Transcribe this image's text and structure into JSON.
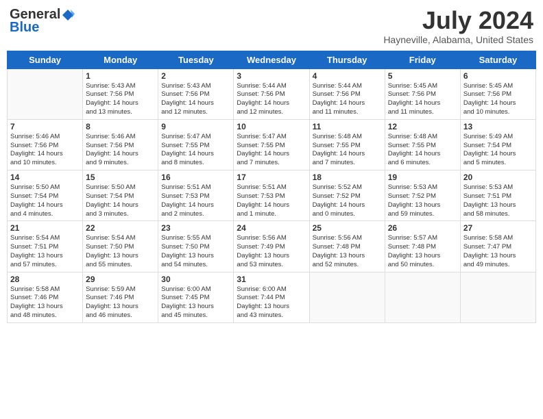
{
  "header": {
    "logo_general": "General",
    "logo_blue": "Blue",
    "month_title": "July 2024",
    "location": "Hayneville, Alabama, United States"
  },
  "days_of_week": [
    "Sunday",
    "Monday",
    "Tuesday",
    "Wednesday",
    "Thursday",
    "Friday",
    "Saturday"
  ],
  "weeks": [
    [
      {
        "day": "",
        "info": ""
      },
      {
        "day": "1",
        "info": "Sunrise: 5:43 AM\nSunset: 7:56 PM\nDaylight: 14 hours\nand 13 minutes."
      },
      {
        "day": "2",
        "info": "Sunrise: 5:43 AM\nSunset: 7:56 PM\nDaylight: 14 hours\nand 12 minutes."
      },
      {
        "day": "3",
        "info": "Sunrise: 5:44 AM\nSunset: 7:56 PM\nDaylight: 14 hours\nand 12 minutes."
      },
      {
        "day": "4",
        "info": "Sunrise: 5:44 AM\nSunset: 7:56 PM\nDaylight: 14 hours\nand 11 minutes."
      },
      {
        "day": "5",
        "info": "Sunrise: 5:45 AM\nSunset: 7:56 PM\nDaylight: 14 hours\nand 11 minutes."
      },
      {
        "day": "6",
        "info": "Sunrise: 5:45 AM\nSunset: 7:56 PM\nDaylight: 14 hours\nand 10 minutes."
      }
    ],
    [
      {
        "day": "7",
        "info": "Sunrise: 5:46 AM\nSunset: 7:56 PM\nDaylight: 14 hours\nand 10 minutes."
      },
      {
        "day": "8",
        "info": "Sunrise: 5:46 AM\nSunset: 7:56 PM\nDaylight: 14 hours\nand 9 minutes."
      },
      {
        "day": "9",
        "info": "Sunrise: 5:47 AM\nSunset: 7:55 PM\nDaylight: 14 hours\nand 8 minutes."
      },
      {
        "day": "10",
        "info": "Sunrise: 5:47 AM\nSunset: 7:55 PM\nDaylight: 14 hours\nand 7 minutes."
      },
      {
        "day": "11",
        "info": "Sunrise: 5:48 AM\nSunset: 7:55 PM\nDaylight: 14 hours\nand 7 minutes."
      },
      {
        "day": "12",
        "info": "Sunrise: 5:48 AM\nSunset: 7:55 PM\nDaylight: 14 hours\nand 6 minutes."
      },
      {
        "day": "13",
        "info": "Sunrise: 5:49 AM\nSunset: 7:54 PM\nDaylight: 14 hours\nand 5 minutes."
      }
    ],
    [
      {
        "day": "14",
        "info": "Sunrise: 5:50 AM\nSunset: 7:54 PM\nDaylight: 14 hours\nand 4 minutes."
      },
      {
        "day": "15",
        "info": "Sunrise: 5:50 AM\nSunset: 7:54 PM\nDaylight: 14 hours\nand 3 minutes."
      },
      {
        "day": "16",
        "info": "Sunrise: 5:51 AM\nSunset: 7:53 PM\nDaylight: 14 hours\nand 2 minutes."
      },
      {
        "day": "17",
        "info": "Sunrise: 5:51 AM\nSunset: 7:53 PM\nDaylight: 14 hours\nand 1 minute."
      },
      {
        "day": "18",
        "info": "Sunrise: 5:52 AM\nSunset: 7:52 PM\nDaylight: 14 hours\nand 0 minutes."
      },
      {
        "day": "19",
        "info": "Sunrise: 5:53 AM\nSunset: 7:52 PM\nDaylight: 13 hours\nand 59 minutes."
      },
      {
        "day": "20",
        "info": "Sunrise: 5:53 AM\nSunset: 7:51 PM\nDaylight: 13 hours\nand 58 minutes."
      }
    ],
    [
      {
        "day": "21",
        "info": "Sunrise: 5:54 AM\nSunset: 7:51 PM\nDaylight: 13 hours\nand 57 minutes."
      },
      {
        "day": "22",
        "info": "Sunrise: 5:54 AM\nSunset: 7:50 PM\nDaylight: 13 hours\nand 55 minutes."
      },
      {
        "day": "23",
        "info": "Sunrise: 5:55 AM\nSunset: 7:50 PM\nDaylight: 13 hours\nand 54 minutes."
      },
      {
        "day": "24",
        "info": "Sunrise: 5:56 AM\nSunset: 7:49 PM\nDaylight: 13 hours\nand 53 minutes."
      },
      {
        "day": "25",
        "info": "Sunrise: 5:56 AM\nSunset: 7:48 PM\nDaylight: 13 hours\nand 52 minutes."
      },
      {
        "day": "26",
        "info": "Sunrise: 5:57 AM\nSunset: 7:48 PM\nDaylight: 13 hours\nand 50 minutes."
      },
      {
        "day": "27",
        "info": "Sunrise: 5:58 AM\nSunset: 7:47 PM\nDaylight: 13 hours\nand 49 minutes."
      }
    ],
    [
      {
        "day": "28",
        "info": "Sunrise: 5:58 AM\nSunset: 7:46 PM\nDaylight: 13 hours\nand 48 minutes."
      },
      {
        "day": "29",
        "info": "Sunrise: 5:59 AM\nSunset: 7:46 PM\nDaylight: 13 hours\nand 46 minutes."
      },
      {
        "day": "30",
        "info": "Sunrise: 6:00 AM\nSunset: 7:45 PM\nDaylight: 13 hours\nand 45 minutes."
      },
      {
        "day": "31",
        "info": "Sunrise: 6:00 AM\nSunset: 7:44 PM\nDaylight: 13 hours\nand 43 minutes."
      },
      {
        "day": "",
        "info": ""
      },
      {
        "day": "",
        "info": ""
      },
      {
        "day": "",
        "info": ""
      }
    ]
  ]
}
